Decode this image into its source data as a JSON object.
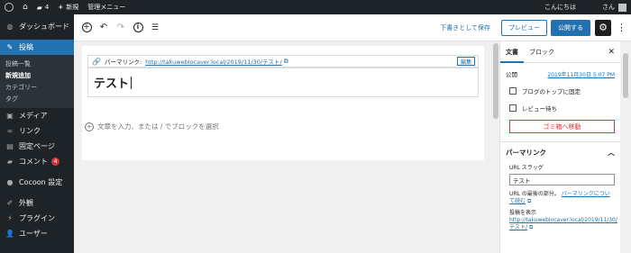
{
  "adminbar": {
    "comments_count": "4",
    "new_label": "新規",
    "admin_menu_label": "管理メニュー",
    "greeting": "こんにちは",
    "user_suffix": "さん"
  },
  "sidebar": {
    "dashboard": "ダッシュボード",
    "posts": "投稿",
    "posts_submenu": [
      "投稿一覧",
      "新規追加",
      "カテゴリー",
      "タグ"
    ],
    "media": "メディア",
    "links": "リンク",
    "pages": "固定ページ",
    "comments": "コメント",
    "comments_badge": "4",
    "cocoon": "Cocoon 設定",
    "appearance": "外観",
    "plugins": "プラグイン",
    "users": "ユーザー"
  },
  "header": {
    "save_draft": "下書きとして保存",
    "preview": "プレビュー",
    "publish": "公開する"
  },
  "editor": {
    "permalink_label": "パーマリンク:",
    "permalink_url": "http://takuweblocaver.local/2019/11/30/テスト/",
    "permalink_edit": "編集",
    "title": "テスト",
    "appender_placeholder": "文章を入力、または / でブロックを選択"
  },
  "settings": {
    "tab_document": "文書",
    "tab_block": "ブロック",
    "publish_label": "公開",
    "publish_value": "2019年11月30日 5:07 PM",
    "sticky_label": "ブログのトップに固定",
    "pending_label": "レビュー待ち",
    "trash_button": "ゴミ箱へ移動",
    "permalink_section": "パーマリンク",
    "slug_label": "URL スラッグ",
    "slug_value": "テスト",
    "help_prefix": "URL の最後の部分。",
    "help_link": "パーマリンクについて読む",
    "view_post_label": "投稿を表示",
    "view_post_url": "http://takuweblocaver.local/2019/11/30/テスト/"
  }
}
